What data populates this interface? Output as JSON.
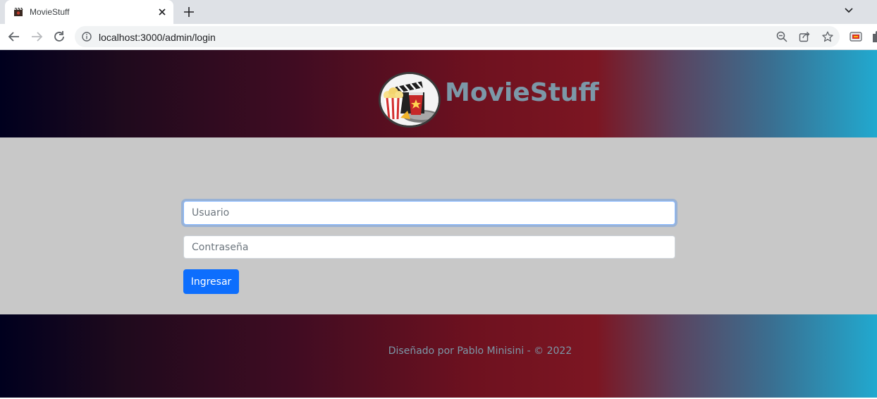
{
  "browser": {
    "tab": {
      "title": "MovieStuff",
      "favicon": "clapperboard-favicon"
    },
    "url": "localhost:3000/admin/login",
    "icons": [
      "back-icon",
      "forward-icon",
      "reload-icon",
      "site-info-icon",
      "zoom-icon",
      "share-icon",
      "bookmark-star-icon",
      "extension-icon",
      "puzzle-icon",
      "close-icon",
      "plus-icon",
      "chevron-down-icon"
    ]
  },
  "header": {
    "brand": "MovieStuff",
    "logo": "popcorn-clapperboard-logo"
  },
  "login_form": {
    "username_placeholder": "Usuario",
    "password_placeholder": "Contraseña",
    "submit_label": "Ingresar"
  },
  "footer": {
    "text": "Diseñado por Pablo Minisini - © 2022"
  },
  "colors": {
    "brand_text": "#7c98a8",
    "page_bg": "#c8c8c8",
    "button": "#0d6efd",
    "gradient_start": "#00001e",
    "gradient_mid": "#7c1622",
    "gradient_end": "#21a9cf"
  }
}
